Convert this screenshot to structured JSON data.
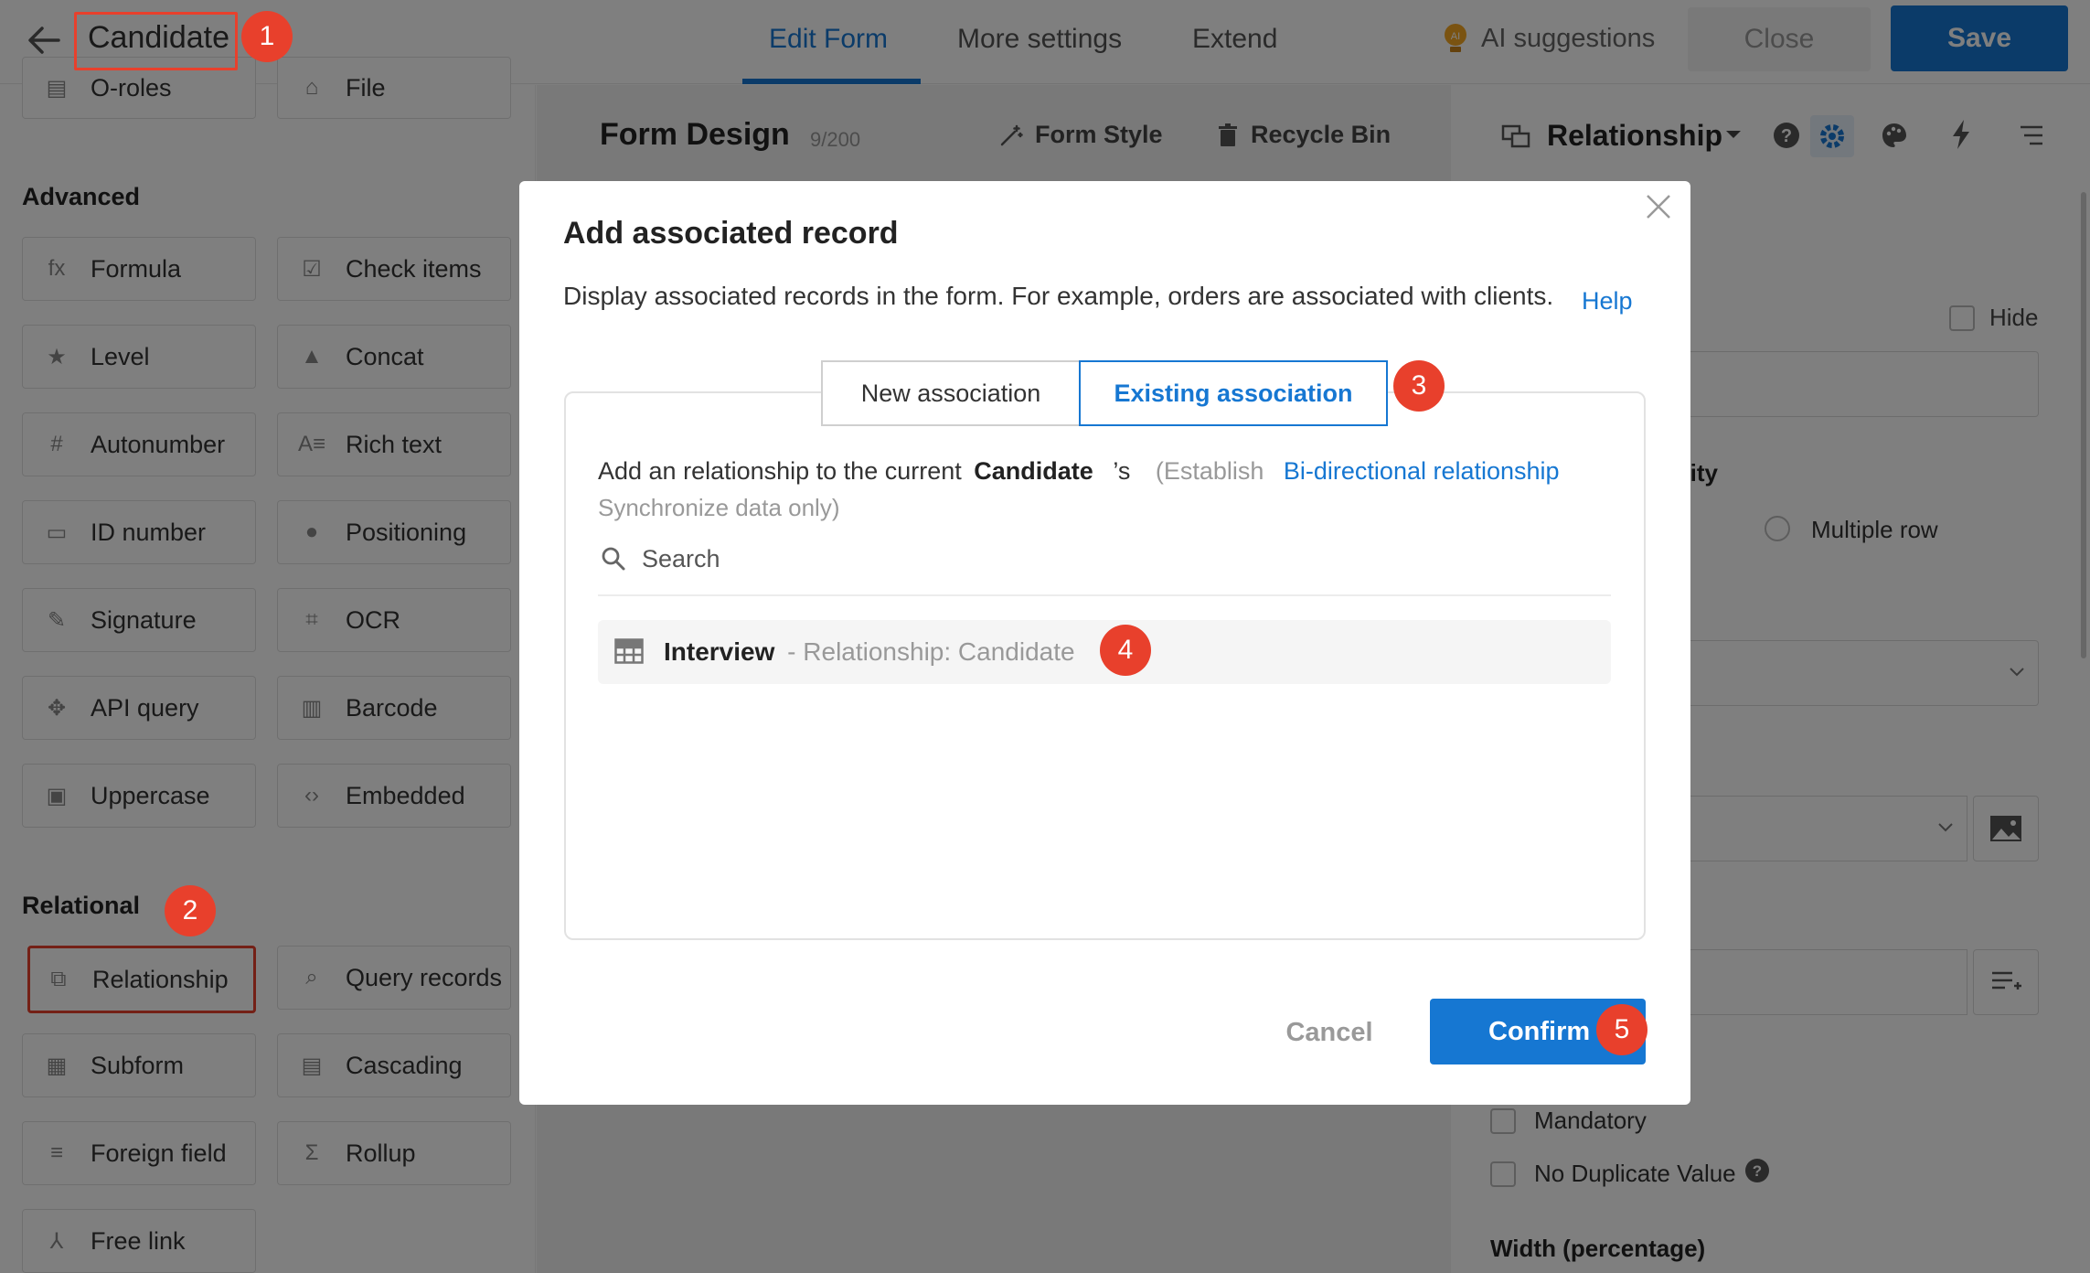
{
  "header": {
    "title": "Candidate",
    "tabs": [
      {
        "label": "Edit Form"
      },
      {
        "label": "More settings"
      },
      {
        "label": "Extend"
      }
    ],
    "ai_suggestions": "AI suggestions",
    "close_label": "Close",
    "save_label": "Save"
  },
  "left_panel": {
    "top_items": [
      {
        "label": "O-roles"
      },
      {
        "label": "File"
      }
    ],
    "advanced_title": "Advanced",
    "advanced_items": [
      {
        "label": "Formula",
        "icon": "fx-icon"
      },
      {
        "label": "Check items",
        "icon": "checkbox-icon"
      },
      {
        "label": "Level",
        "icon": "star-icon"
      },
      {
        "label": "Concat",
        "icon": "shapes-icon"
      },
      {
        "label": "Autonumber",
        "icon": "hash-icon"
      },
      {
        "label": "Rich text",
        "icon": "rich-text-icon"
      },
      {
        "label": "ID number",
        "icon": "id-card-icon"
      },
      {
        "label": "Positioning",
        "icon": "pin-icon"
      },
      {
        "label": "Signature",
        "icon": "signature-icon"
      },
      {
        "label": "OCR",
        "icon": "ocr-icon"
      },
      {
        "label": "API query",
        "icon": "api-icon"
      },
      {
        "label": "Barcode",
        "icon": "barcode-icon"
      },
      {
        "label": "Uppercase",
        "icon": "uppercase-icon"
      },
      {
        "label": "Embedded",
        "icon": "code-icon"
      }
    ],
    "relational_title": "Relational",
    "relational_items": [
      {
        "label": "Relationship",
        "icon": "relationship-icon"
      },
      {
        "label": "Query records",
        "icon": "query-icon"
      },
      {
        "label": "Subform",
        "icon": "table-icon"
      },
      {
        "label": "Cascading",
        "icon": "cascade-icon"
      },
      {
        "label": "Foreign field",
        "icon": "foreign-field-icon"
      },
      {
        "label": "Rollup",
        "icon": "sigma-icon"
      },
      {
        "label": "Free link",
        "icon": "link-icon"
      }
    ]
  },
  "center_panel": {
    "title": "Form Design",
    "count": "9/200",
    "form_style": "Form Style",
    "recycle_bin": "Recycle Bin"
  },
  "right_panel": {
    "title": "Relationship",
    "hide_label": "Hide",
    "partial_label": "tity",
    "multiple_row": "Multiple row",
    "mandatory": "Mandatory",
    "no_duplicate": "No Duplicate Value",
    "width_label": "Width (percentage)"
  },
  "modal": {
    "title": "Add associated record",
    "description": "Display associated records in the form. For example, orders are associated with clients.",
    "help": "Help",
    "tab_new": "New association",
    "tab_existing": "Existing association",
    "add_prefix": "Add an relationship to the current",
    "add_entity": "Candidate",
    "add_suffix": "’s",
    "establish": "(Establish",
    "bidirectional": "Bi-directional relationship",
    "sync_only": "Synchronize data only)",
    "search_placeholder": "Search",
    "record_name": "Interview",
    "record_detail": "- Relationship: Candidate",
    "cancel": "Cancel",
    "confirm": "Confirm"
  },
  "annotations": [
    "1",
    "2",
    "3",
    "4",
    "5"
  ],
  "colors": {
    "accent": "#1677d2",
    "annotation": "#e8402c"
  }
}
